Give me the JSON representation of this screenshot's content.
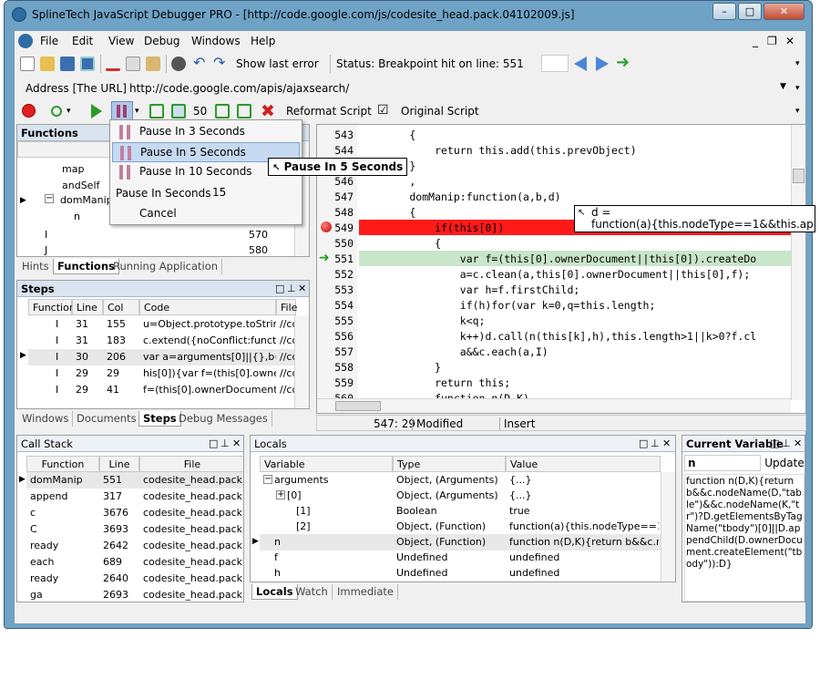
{
  "window": {
    "title": "SplineTech JavaScript Debugger PRO - [http://code.google.com/js/codesite_head.pack.04102009.js]",
    "min": "–",
    "max": "□",
    "close": "✕"
  },
  "menu": {
    "items": [
      "File",
      "Edit",
      "View",
      "Debug",
      "Windows",
      "Help"
    ],
    "mdi": [
      "_",
      "❐",
      "✕"
    ]
  },
  "toolbar": {
    "show_last_error": "Show last error",
    "status": "Status: Breakpoint hit on line: 551"
  },
  "address": {
    "label": "Address [The URL]",
    "value": "http://code.google.com/apis/ajaxsearch/"
  },
  "debugbar": {
    "step_count": "50",
    "reformat": "Reformat Script",
    "reformat_checked": "☑",
    "original": "Original Script"
  },
  "functions": {
    "title": "Functions",
    "rows": [
      {
        "name": "map",
        "line": ""
      },
      {
        "name": "andSelf",
        "line": ""
      },
      {
        "name": "domManip",
        "line": ""
      },
      {
        "name": "n",
        "line": ""
      },
      {
        "name": "I",
        "line": "570"
      },
      {
        "name": "J",
        "line": "580"
      }
    ],
    "tabs": [
      "Hints",
      "Functions",
      "Running Application"
    ]
  },
  "pause_menu": {
    "items": [
      "Pause In 3 Seconds",
      "Pause In 5 Seconds",
      "Pause In 10 Seconds"
    ],
    "seconds_label": "Pause In Seconds",
    "seconds_value": "15",
    "cancel": "Cancel"
  },
  "tooltip_pause": "Pause In 5 Seconds",
  "tooltip_var": {
    "line1": "d =",
    "line2": "function(a){this.nodeType==1&&this.ap"
  },
  "steps": {
    "title": "Steps",
    "headers": [
      "Function",
      "Line",
      "Col",
      "Code",
      "File"
    ],
    "rows": [
      {
        "fn": "I",
        "line": "31",
        "col": "155",
        "code": "u=Object.prototype.toString;",
        "file": "//cc"
      },
      {
        "fn": "I",
        "line": "31",
        "col": "183",
        "code": "c.extend({noConflict:function(",
        "file": "//cc"
      },
      {
        "fn": "I",
        "line": "30",
        "col": "206",
        "code": "var a=arguments[0]||{},b=1,",
        "file": "//cc"
      },
      {
        "fn": "I",
        "line": "29",
        "col": "29",
        "code": "his[0]){var f=(this[0].ownerDo",
        "file": "//cc"
      },
      {
        "fn": "I",
        "line": "29",
        "col": "41",
        "code": "f=(this[0].ownerDocument||th",
        "file": "//cc"
      }
    ],
    "tabs": [
      "Windows",
      "Documents",
      "Steps",
      "Debug Messages"
    ]
  },
  "editor": {
    "lines": [
      {
        "n": "543",
        "t": "        {"
      },
      {
        "n": "544",
        "t": "            return this.add(this.prevObject)"
      },
      {
        "n": "545",
        "t": "        }"
      },
      {
        "n": "546",
        "t": "        ,"
      },
      {
        "n": "547",
        "t": "        domManip:function(a,b,d)"
      },
      {
        "n": "548",
        "t": "        {"
      },
      {
        "n": "549",
        "t": "            if(this[0])"
      },
      {
        "n": "550",
        "t": "            {"
      },
      {
        "n": "551",
        "t": "                var f=(this[0].ownerDocument||this[0]).createDo"
      },
      {
        "n": "552",
        "t": "                a=c.clean(a,this[0].ownerDocument||this[0],f);"
      },
      {
        "n": "553",
        "t": "                var h=f.firstChild;"
      },
      {
        "n": "554",
        "t": "                if(h)for(var k=0,q=this.length;"
      },
      {
        "n": "555",
        "t": "                k<q;"
      },
      {
        "n": "556",
        "t": "                k++)d.call(n(this[k],h),this.length>1||k>0?f.cl"
      },
      {
        "n": "557",
        "t": "                a&&c.each(a,I)"
      },
      {
        "n": "558",
        "t": "            }"
      },
      {
        "n": "559",
        "t": "            return this;"
      },
      {
        "n": "560",
        "t": "            function n(D,K)"
      }
    ],
    "status": {
      "pos": "547: 29",
      "modified": "Modified",
      "mode": "Insert"
    }
  },
  "callstack": {
    "title": "Call Stack",
    "headers": [
      "Function",
      "Line",
      "File"
    ],
    "rows": [
      {
        "fn": "domManip",
        "line": "551",
        "file": "codesite_head.pack"
      },
      {
        "fn": "append",
        "line": "317",
        "file": "codesite_head.pack"
      },
      {
        "fn": "c",
        "line": "3676",
        "file": "codesite_head.pack"
      },
      {
        "fn": "C",
        "line": "3693",
        "file": "codesite_head.pack"
      },
      {
        "fn": "ready",
        "line": "2642",
        "file": "codesite_head.pack"
      },
      {
        "fn": "each",
        "line": "689",
        "file": "codesite_head.pack"
      },
      {
        "fn": "ready",
        "line": "2640",
        "file": "codesite_head.pack"
      },
      {
        "fn": "ga",
        "line": "2693",
        "file": "codesite_head.pack"
      }
    ]
  },
  "locals": {
    "title": "Locals",
    "headers": [
      "Variable",
      "Type",
      "Value"
    ],
    "rows": [
      {
        "var": "arguments",
        "type": "Object, (Arguments)",
        "value": "{...}"
      },
      {
        "var": "[0]",
        "type": "Object, (Arguments)",
        "value": "{...}"
      },
      {
        "var": "[1]",
        "type": "Boolean",
        "value": "true"
      },
      {
        "var": "[2]",
        "type": "Object, (Function)",
        "value": "function(a){this.nodeType==1&&"
      },
      {
        "var": "n",
        "type": "Object, (Function)",
        "value": "function n(D,K){return b&&c.node"
      },
      {
        "var": "f",
        "type": "Undefined",
        "value": "undefined"
      },
      {
        "var": "h",
        "type": "Undefined",
        "value": "undefined"
      }
    ],
    "tabs": [
      "Locals",
      "Watch",
      "Immediate"
    ]
  },
  "current_variable": {
    "title": "Current Variable",
    "name": "n",
    "update": "Update",
    "value": "function n(D,K){return b&&c.nodeName(D,\"table\")&&c.nodeName(K,\"tr\")?D.getElementsByTagName(\"tbody\")[0]||D.appendChild(D.ownerDocument.createElement(\"tbody\")):D}"
  }
}
